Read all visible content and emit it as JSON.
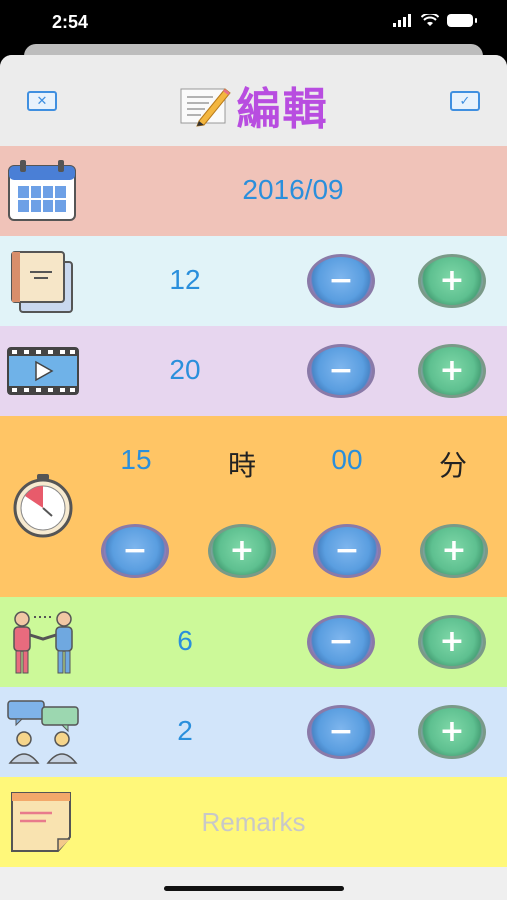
{
  "status": {
    "time": "2:54"
  },
  "nav": {
    "title": "編輯",
    "cancel_icon": "x-box-icon",
    "confirm_icon": "check-box-icon",
    "cancel_glyph": "✕",
    "confirm_glyph": "✓"
  },
  "rows": {
    "date": {
      "value": "2016/09",
      "color": "#f0c3b9"
    },
    "count1": {
      "value": "12",
      "color": "#e1f3f8"
    },
    "count2": {
      "value": "20",
      "color": "#e7d6ef"
    },
    "time": {
      "hour": "15",
      "hour_unit": "時",
      "minute": "00",
      "minute_unit": "分",
      "color": "#ffc565"
    },
    "people": {
      "value": "6",
      "color": "#ccf999"
    },
    "chat": {
      "value": "2",
      "color": "#d2e5fa"
    },
    "remarks": {
      "placeholder": "Remarks",
      "color": "#fff87a"
    }
  },
  "buttons": {
    "minus": "−",
    "plus": "+"
  }
}
